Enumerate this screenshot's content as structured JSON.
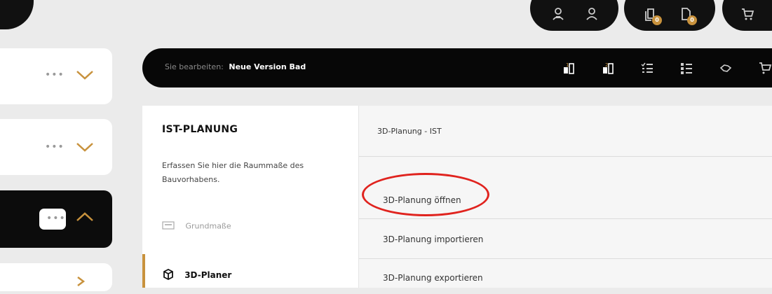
{
  "top_bar": {
    "icons": [
      "user-group-icon",
      "user-icon",
      "copy-document-icon",
      "document-icon",
      "cart-icon"
    ],
    "badges": [
      "0",
      "0"
    ]
  },
  "sidebar": {
    "cards": [
      {
        "state": "collapsed",
        "dots": "•••"
      },
      {
        "state": "collapsed",
        "dots": "•••"
      },
      {
        "state": "expanded",
        "dots": "•••"
      }
    ]
  },
  "editbar": {
    "label": "Sie bearbeiten:",
    "name": "Neue Version Bad",
    "icons": [
      "floor-plan-1-icon",
      "floor-plan-2-icon",
      "checklist-1-icon",
      "checklist-2-icon",
      "handshake-icon",
      "cart-icon"
    ]
  },
  "panel": {
    "title": "IST-PLANUNG",
    "description": "Erfassen Sie hier die Raummaße des Bauvorhabens.",
    "nav": [
      {
        "label": "Grundmaße",
        "icon": "keyboard-icon"
      },
      {
        "label": "3D-Planer",
        "icon": "cube-icon"
      }
    ],
    "right_title": "3D-Planung - IST",
    "rows": [
      {
        "label": "3D-Planung öffnen"
      },
      {
        "label": "3D-Planung importieren"
      },
      {
        "label": "3D-Planung exportieren"
      }
    ]
  },
  "colors": {
    "accent": "#c8923d",
    "highlight": "#e0231e",
    "dark": "#070707"
  }
}
